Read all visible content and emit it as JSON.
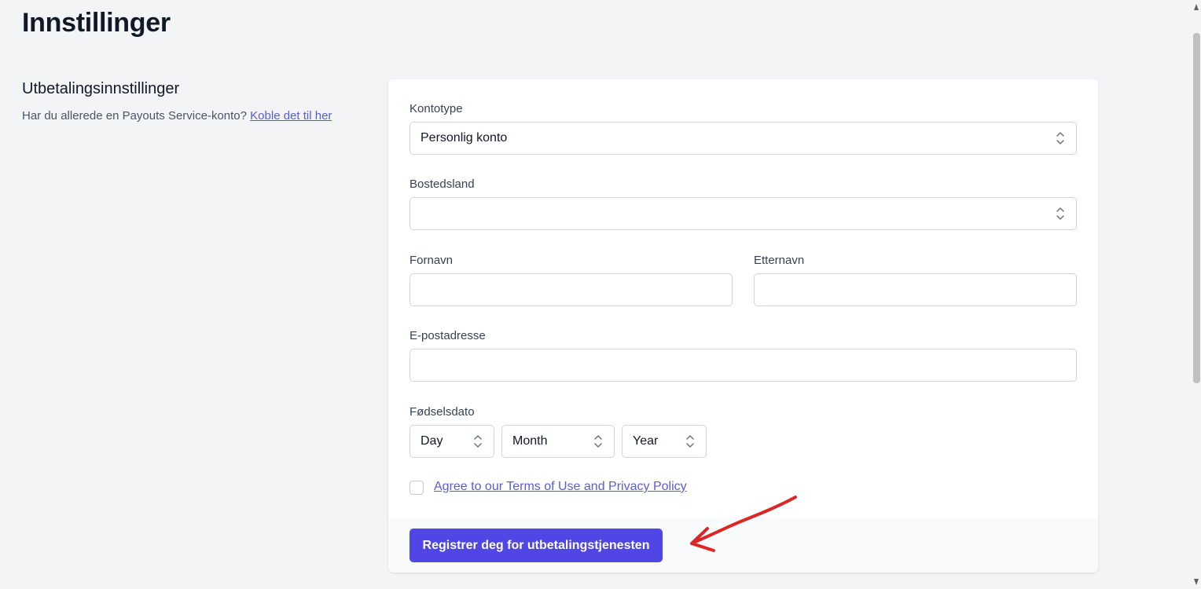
{
  "page": {
    "title": "Innstillinger"
  },
  "section": {
    "title": "Utbetalingsinnstillinger",
    "description": "Har du allerede en Payouts Service-konto?",
    "link_text": "Koble det til her"
  },
  "form": {
    "account_type": {
      "label": "Kontotype",
      "value": "Personlig konto"
    },
    "country": {
      "label": "Bostedsland",
      "value": ""
    },
    "first_name": {
      "label": "Fornavn",
      "value": ""
    },
    "last_name": {
      "label": "Etternavn",
      "value": ""
    },
    "email": {
      "label": "E-postadresse",
      "value": ""
    },
    "birthdate": {
      "label": "Fødselsdato",
      "day": "Day",
      "month": "Month",
      "year": "Year"
    },
    "terms": {
      "checked": false,
      "label": "Agree to our Terms of Use and Privacy Policy"
    },
    "submit_label": "Registrer deg for utbetalingstjenesten"
  },
  "colors": {
    "accent": "#4f46e5",
    "link": "#5b5bd6",
    "annotation_arrow": "#dc2626"
  },
  "icons": [
    "select-chevrons-icon",
    "scroll-up-arrow-icon",
    "scroll-down-arrow-icon",
    "annotation-arrow-icon"
  ]
}
